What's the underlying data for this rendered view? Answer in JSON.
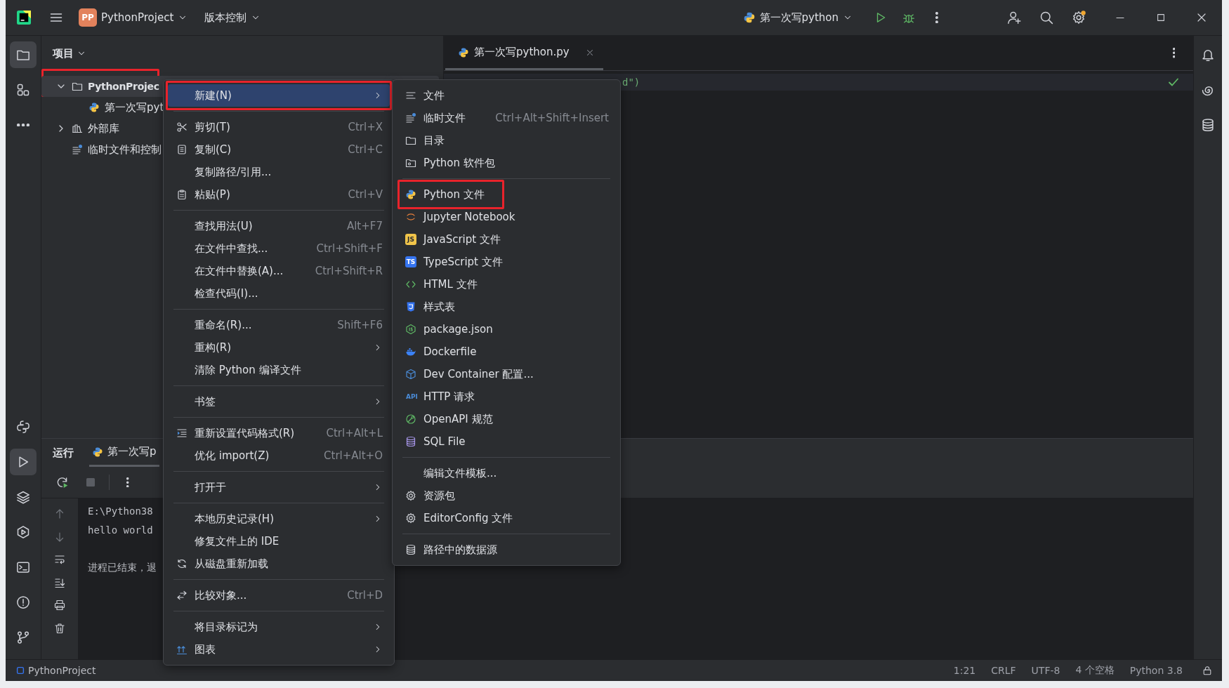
{
  "title_bar": {
    "project_badge": "PP",
    "project": "PythonProject",
    "vcs": "版本控制",
    "run_config": "第一次写python"
  },
  "tool_strip": {
    "top": [
      {
        "selected": true
      },
      {
        "selected": false
      },
      {
        "selected": false
      }
    ],
    "bottom": [
      {
        "selected": false
      },
      {
        "selected": true
      },
      {
        "selected": false
      },
      {
        "selected": false
      },
      {
        "selected": false
      },
      {
        "selected": false
      },
      {
        "selected": false
      }
    ]
  },
  "project_panel": {
    "title": "项目",
    "tree": [
      {
        "label": "PythonProjec",
        "kind": "folder",
        "expanded": true,
        "selected": true,
        "highlighted": true,
        "children": [
          {
            "label": "第一次写pyt",
            "kind": "python",
            "selected": false
          }
        ]
      },
      {
        "label": "外部库",
        "kind": "library",
        "expanded": false,
        "selected": false
      },
      {
        "label": "临时文件和控制",
        "kind": "scratch",
        "selected": false
      }
    ]
  },
  "editor": {
    "tabs": [
      {
        "label": "第一次写python.py",
        "selected": true
      }
    ],
    "code_fragment": "d\")"
  },
  "run_panel": {
    "title": "运行",
    "tabs": [
      {
        "label": "第一次写p",
        "selected": true
      }
    ],
    "output": [
      [
        "E:\\Python38",
        "hello world"
      ],
      [
        "进程已结束，退"
      ]
    ]
  },
  "status_bar": {
    "project": "PythonProject",
    "items": [
      "1:21",
      "CRLF",
      "UTF-8",
      "4 个空格",
      "Python 3.8"
    ]
  },
  "context_menu": {
    "groups": [
      [
        {
          "label": "新建(N)",
          "submenu": true,
          "selected": true,
          "highlighted": true
        }
      ],
      [
        {
          "label": "剪切(T)",
          "shortcut": "Ctrl+X",
          "selected": false
        },
        {
          "label": "复制(C)",
          "shortcut": "Ctrl+C",
          "selected": false
        },
        {
          "label": "复制路径/引用...",
          "selected": false
        },
        {
          "label": "粘贴(P)",
          "shortcut": "Ctrl+V",
          "selected": false
        }
      ],
      [
        {
          "label": "查找用法(U)",
          "shortcut": "Alt+F7",
          "selected": false
        },
        {
          "label": "在文件中查找...",
          "shortcut": "Ctrl+Shift+F",
          "selected": false
        },
        {
          "label": "在文件中替换(A)...",
          "shortcut": "Ctrl+Shift+R",
          "selected": false
        },
        {
          "label": "检查代码(I)...",
          "selected": false
        }
      ],
      [
        {
          "label": "重命名(R)...",
          "shortcut": "Shift+F6",
          "selected": false
        },
        {
          "label": "重构(R)",
          "submenu": true,
          "selected": false
        },
        {
          "label": "清除 Python 编译文件",
          "selected": false
        }
      ],
      [
        {
          "label": "书签",
          "submenu": true,
          "selected": false
        }
      ],
      [
        {
          "label": "重新设置代码格式(R)",
          "shortcut": "Ctrl+Alt+L",
          "selected": false
        },
        {
          "label": "优化 import(Z)",
          "shortcut": "Ctrl+Alt+O",
          "selected": false
        }
      ],
      [
        {
          "label": "打开于",
          "submenu": true,
          "selected": false
        }
      ],
      [
        {
          "label": "本地历史记录(H)",
          "submenu": true,
          "selected": false
        },
        {
          "label": "修复文件上的 IDE",
          "selected": false
        },
        {
          "label": "从磁盘重新加载",
          "selected": false
        }
      ],
      [
        {
          "label": "比较对象...",
          "shortcut": "Ctrl+D",
          "selected": false
        }
      ],
      [
        {
          "label": "将目录标记为",
          "submenu": true,
          "selected": false
        },
        {
          "label": "图表",
          "submenu": true,
          "selected": false
        }
      ]
    ]
  },
  "new_submenu": {
    "groups": [
      [
        {
          "label": "文件",
          "selected": false
        },
        {
          "label": "临时文件",
          "shortcut": "Ctrl+Alt+Shift+Insert",
          "selected": false
        },
        {
          "label": "目录",
          "selected": false
        },
        {
          "label": "Python 软件包",
          "selected": false
        }
      ],
      [
        {
          "label": "Python 文件",
          "selected": false,
          "highlighted": true
        },
        {
          "label": "Jupyter Notebook",
          "selected": false
        },
        {
          "label": "JavaScript 文件",
          "badge": "JS",
          "selected": false
        },
        {
          "label": "TypeScript 文件",
          "badge": "TS",
          "selected": false
        },
        {
          "label": "HTML 文件",
          "selected": false
        },
        {
          "label": "样式表",
          "selected": false
        },
        {
          "label": "package.json",
          "selected": false
        },
        {
          "label": "Dockerfile",
          "selected": false
        },
        {
          "label": "Dev Container 配置...",
          "selected": false
        },
        {
          "label": "HTTP 请求",
          "badge": "API",
          "selected": false
        },
        {
          "label": "OpenAPI 规范",
          "selected": false
        },
        {
          "label": "SQL File",
          "selected": false
        }
      ],
      [
        {
          "label": "编辑文件模板...",
          "selected": false
        },
        {
          "label": "资源包",
          "selected": false
        },
        {
          "label": "EditorConfig 文件",
          "selected": false
        }
      ],
      [
        {
          "label": "路径中的数据源",
          "selected": false
        }
      ]
    ]
  }
}
